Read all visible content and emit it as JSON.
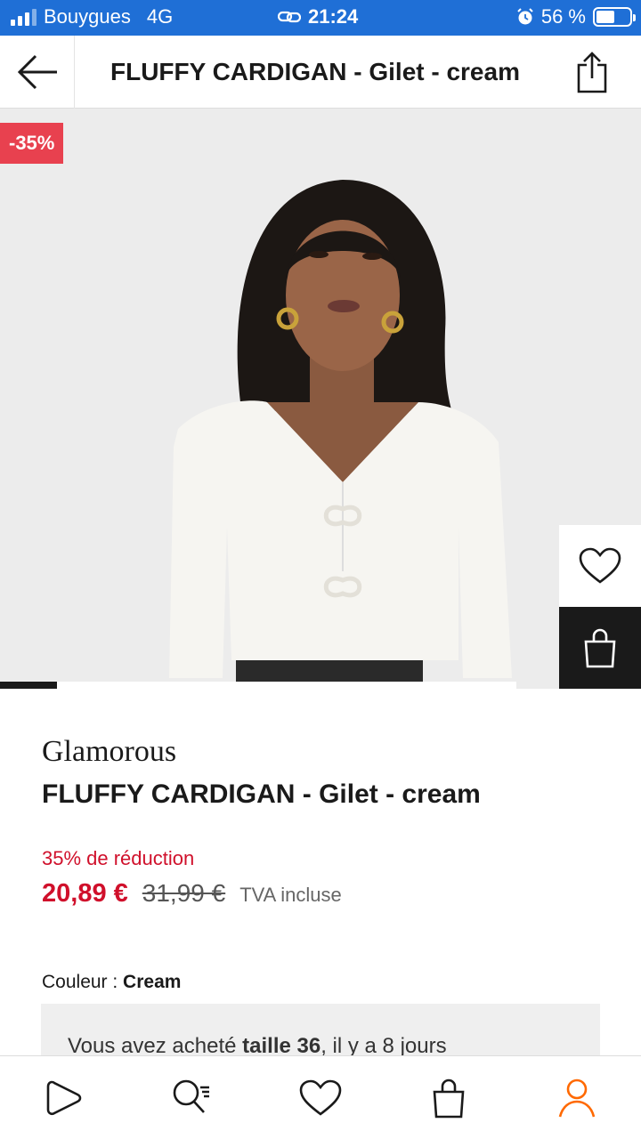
{
  "status_bar": {
    "carrier": "Bouygues",
    "network": "4G",
    "time": "21:24",
    "battery": "56 %",
    "battery_level": 0.56
  },
  "header": {
    "title": "FLUFFY CARDIGAN - Gilet - cream"
  },
  "hero": {
    "discount_badge": "-35%",
    "image_progress": 0.11
  },
  "product": {
    "brand": "Glamorous",
    "name": "FLUFFY CARDIGAN - Gilet - cream",
    "discount_text": "35% de réduction",
    "price_now": "20,89 €",
    "price_old": "31,99 €",
    "vat_label": "TVA incluse",
    "color_label": "Couleur : ",
    "color_value": "Cream"
  },
  "purchase_notice": {
    "prefix": "Vous avez acheté ",
    "size": "taille 36",
    "suffix": ", il y a 8 jours"
  },
  "colors": {
    "status_bar": "#1f6fd6",
    "sale_red": "#d0102b",
    "badge_red": "#e8414f",
    "active_nav": "#ff6900"
  },
  "icons": {
    "back": "arrow-left-icon",
    "share": "share-icon",
    "favorite": "heart-icon",
    "bag": "shopping-bag-icon",
    "nav": [
      "home-icon",
      "search-icon",
      "heart-icon",
      "bag-icon",
      "user-icon"
    ]
  }
}
